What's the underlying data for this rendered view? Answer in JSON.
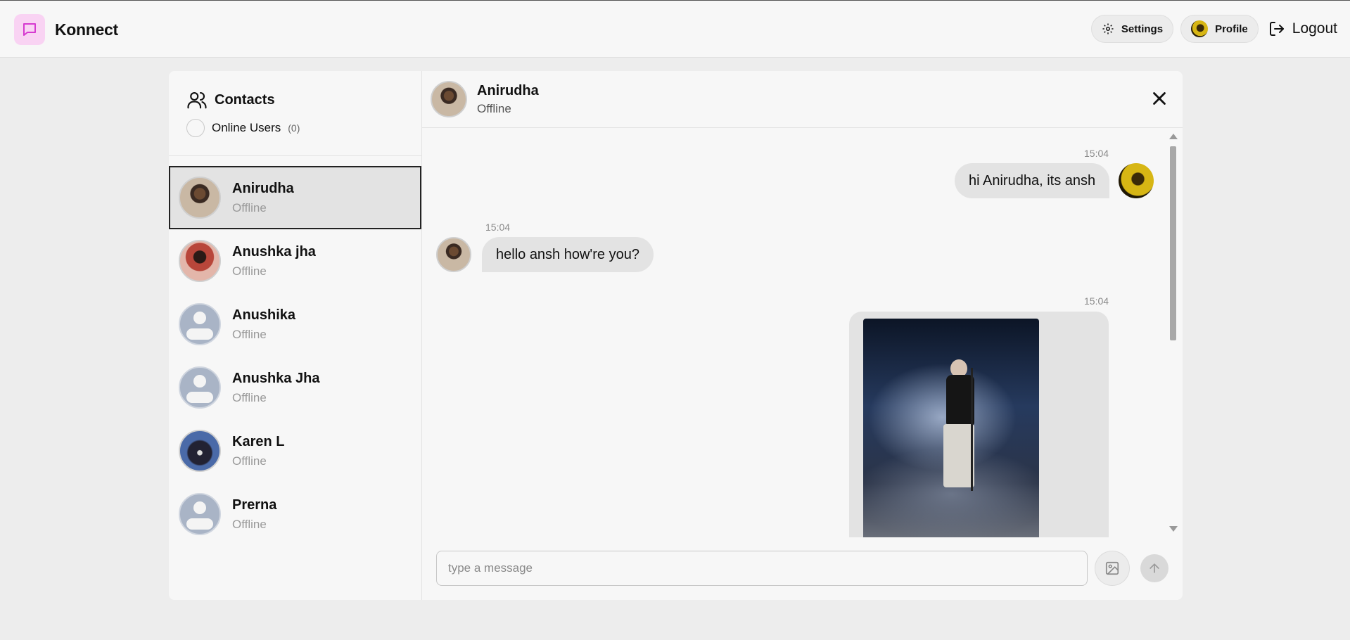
{
  "app": {
    "name": "Konnect",
    "brand_color": "#f9d3f3",
    "logo_icon": "chat-bubble-icon"
  },
  "nav": {
    "settings_label": "Settings",
    "profile_label": "Profile",
    "logout_label": "Logout"
  },
  "sidebar": {
    "title": "Contacts",
    "filter_label": "Online Users",
    "online_count": "(0)",
    "contacts": [
      {
        "name": "Anirudha",
        "status": "Offline",
        "avatar": "photo",
        "selected": true
      },
      {
        "name": "Anushka jha",
        "status": "Offline",
        "avatar": "photo"
      },
      {
        "name": "Anushika",
        "status": "Offline",
        "avatar": "default"
      },
      {
        "name": "Anushka Jha",
        "status": "Offline",
        "avatar": "default"
      },
      {
        "name": "Karen L",
        "status": "Offline",
        "avatar": "photo"
      },
      {
        "name": "Prerna",
        "status": "Offline",
        "avatar": "default"
      }
    ]
  },
  "chat": {
    "contact_name": "Anirudha",
    "contact_status": "Offline",
    "messages": [
      {
        "from": "me",
        "time": "15:04",
        "text": "hi Anirudha, its ansh"
      },
      {
        "from": "them",
        "time": "15:04",
        "text": "hello ansh how're you?"
      },
      {
        "from": "me",
        "time": "15:04",
        "type": "image",
        "text": ""
      }
    ],
    "composer": {
      "placeholder": "type a message",
      "value": ""
    }
  }
}
